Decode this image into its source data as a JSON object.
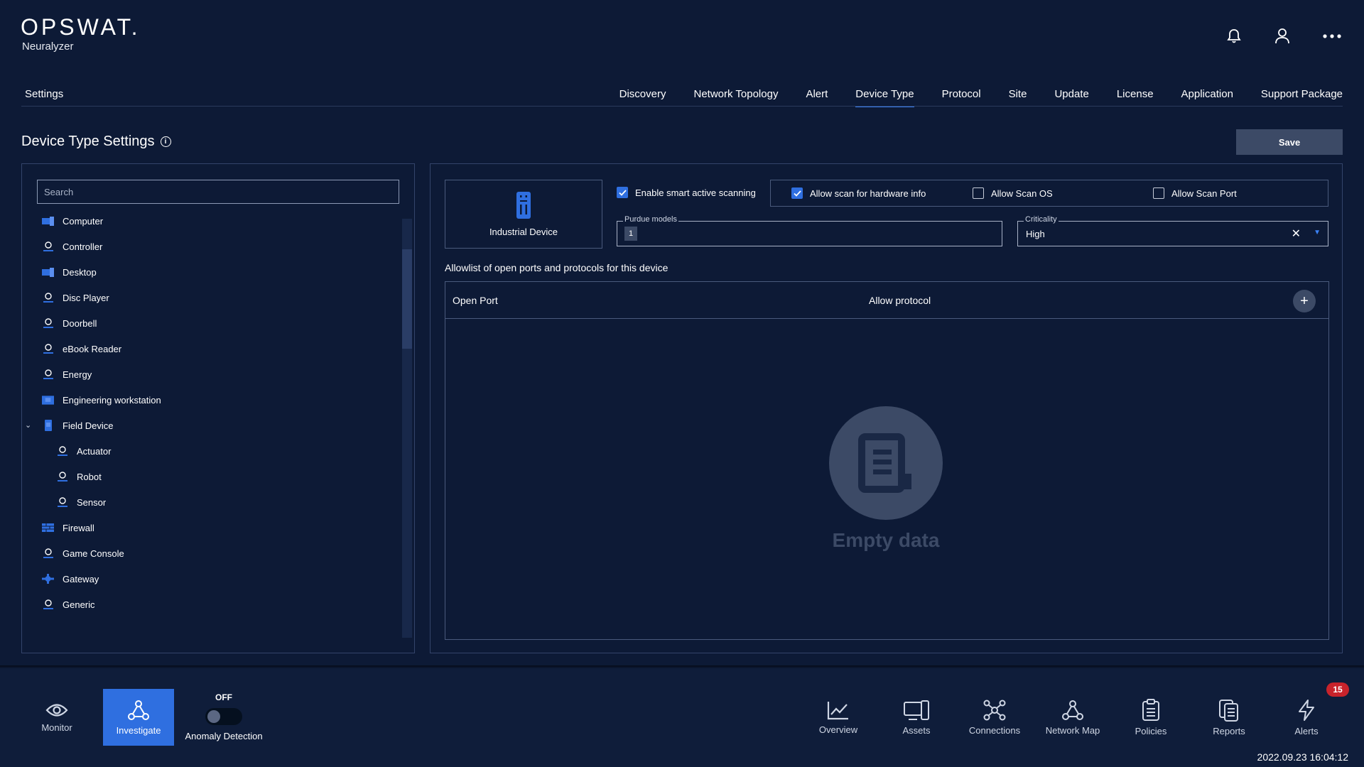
{
  "brand": {
    "logo": "OPSWAT.",
    "product": "Neuralyzer"
  },
  "header": {
    "icons": [
      "bell-icon",
      "user-icon",
      "more-icon"
    ]
  },
  "nav": {
    "settings": "Settings",
    "tabs": [
      "Discovery",
      "Network Topology",
      "Alert",
      "Device Type",
      "Protocol",
      "Site",
      "Update",
      "License",
      "Application",
      "Support Package"
    ],
    "active_tab": "Device Type"
  },
  "page": {
    "title": "Device Type Settings",
    "save": "Save"
  },
  "left": {
    "search_placeholder": "Search",
    "items": [
      {
        "label": "Computer",
        "icon": "computer-icon"
      },
      {
        "label": "Controller",
        "icon": "user-icon"
      },
      {
        "label": "Desktop",
        "icon": "computer-icon"
      },
      {
        "label": "Disc Player",
        "icon": "user-icon"
      },
      {
        "label": "Doorbell",
        "icon": "user-icon"
      },
      {
        "label": "eBook Reader",
        "icon": "user-icon"
      },
      {
        "label": "Energy",
        "icon": "user-icon"
      },
      {
        "label": "Engineering workstation",
        "icon": "workstation-icon"
      },
      {
        "label": "Field Device",
        "icon": "field-device-icon",
        "expanded": true
      },
      {
        "label": "Actuator",
        "icon": "user-icon"
      },
      {
        "label": "Robot",
        "icon": "user-icon"
      },
      {
        "label": "Sensor",
        "icon": "user-icon"
      },
      {
        "label": "Firewall",
        "icon": "firewall-icon"
      },
      {
        "label": "Game Console",
        "icon": "user-icon"
      },
      {
        "label": "Gateway",
        "icon": "gateway-icon"
      },
      {
        "label": "Generic",
        "icon": "user-icon"
      }
    ]
  },
  "right": {
    "device_name": "Industrial Device",
    "smart_scan": {
      "label": "Enable smart active scanning",
      "checked": true
    },
    "scan_options": [
      {
        "label": "Allow scan for hardware info",
        "checked": true
      },
      {
        "label": "Allow Scan OS",
        "checked": false
      },
      {
        "label": "Allow Scan Port",
        "checked": false
      }
    ],
    "purdue": {
      "label": "Purdue models",
      "value": "1"
    },
    "criticality": {
      "label": "Criticality",
      "value": "High"
    },
    "allowlist_text": "Allowlist of open ports and protocols for this device",
    "table": {
      "col1": "Open Port",
      "col2": "Allow protocol"
    },
    "empty": "Empty data"
  },
  "bottom": {
    "monitor": "Monitor",
    "investigate": "Investigate",
    "anomaly": {
      "state": "OFF",
      "label": "Anomaly Detection"
    },
    "items": [
      "Overview",
      "Assets",
      "Connections",
      "Network Map",
      "Policies",
      "Reports",
      "Alerts"
    ],
    "alert_count": "15",
    "timestamp": "2022.09.23 16:04:12"
  },
  "colors": {
    "background": "#0d1a36",
    "accent": "#2f6fe0",
    "muted": "#3c4a66",
    "badge": "#c8232b"
  }
}
